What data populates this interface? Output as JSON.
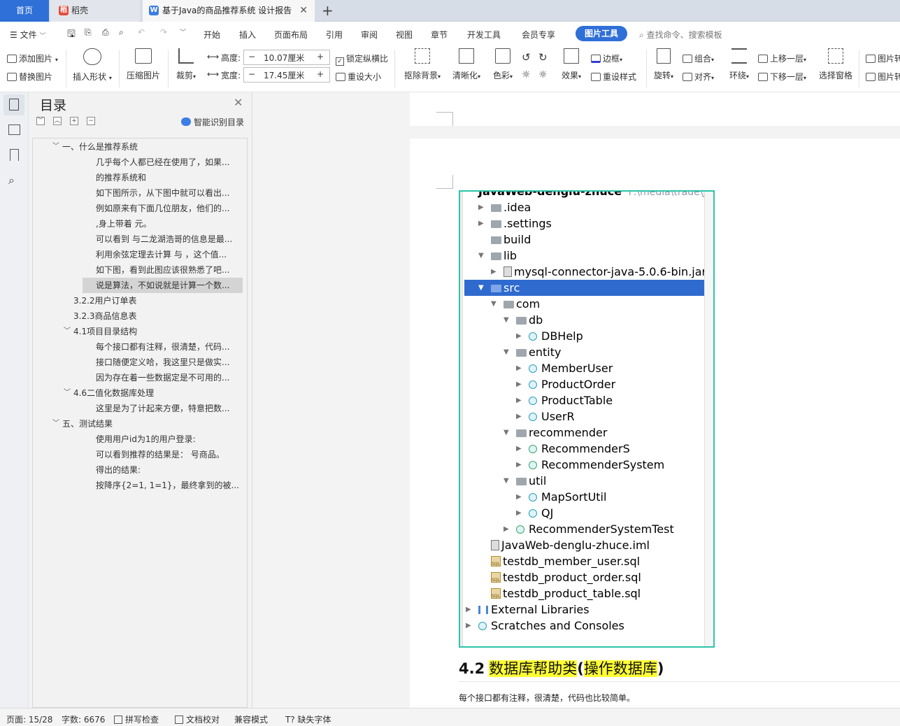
{
  "tabs": {
    "home": "首页",
    "daoke": "稻壳",
    "doc": "基于Java的商品推荐系统 设计报告"
  },
  "menu": {
    "file": "文件",
    "items": [
      "开始",
      "插入",
      "页面布局",
      "引用",
      "审阅",
      "视图",
      "章节",
      "开发工具",
      "会员专享"
    ],
    "active": "图片工具",
    "search": "查找命令、搜索模板"
  },
  "ribbon": {
    "add_picture": "添加图片",
    "replace_picture": "替换图片",
    "insert_shape": "插入形状",
    "compress": "压缩图片",
    "crop": "裁剪",
    "height_label": "高度:",
    "height_value": "10.07厘米",
    "width_label": "宽度:",
    "width_value": "17.45厘米",
    "lock_ratio": "锁定纵横比",
    "reset_size": "重设大小",
    "remove_bg": "抠除背景",
    "sharpen": "清晰化",
    "color": "色彩",
    "effects": "效果",
    "border": "边框",
    "reset_style": "重设样式",
    "rotate": "旋转",
    "group": "组合",
    "align": "对齐",
    "wrap": "环绕",
    "bring_forward": "上移一层",
    "send_backward": "下移一层",
    "select_pane": "选择窗格",
    "picture1": "图片转",
    "picture2": "图片转"
  },
  "toc": {
    "title": "目录",
    "smart": "智能识别目录",
    "items": [
      {
        "text": "一、什么是推荐系统",
        "level": 1,
        "expanded": true
      },
      {
        "text": "几乎每个人都已经在使用了，如果...",
        "level": 3
      },
      {
        "text": "的推荐系统和",
        "level": 3
      },
      {
        "text": "如下图所示，从下图中就可以看出...",
        "level": 3
      },
      {
        "text": "例如原来有下面几位朋友，他们的...",
        "level": 3
      },
      {
        "text": ",身上带着 元。",
        "level": 3
      },
      {
        "text": "可以看到 与二龙湖浩哥的信息是最...",
        "level": 3
      },
      {
        "text": "利用余弦定理去计算 与 ，这个值...",
        "level": 3
      },
      {
        "text": "如下图，看到此图应该很熟悉了吧...",
        "level": 3
      },
      {
        "text": "说是算法，不如说就是计算一个数...",
        "level": 3,
        "selected": true
      },
      {
        "text": "3.2.2用户订单表",
        "level": 2
      },
      {
        "text": "3.2.3商品信息表",
        "level": 2
      },
      {
        "text": "4.1项目目录结构",
        "level": 2,
        "expanded": true
      },
      {
        "text": "每个接口都有注释，很清楚，代码...",
        "level": 3
      },
      {
        "text": "接口随便定义哈，我这里只是做实...",
        "level": 3
      },
      {
        "text": "因为存在着一些数据定是不可用的...",
        "level": 3
      },
      {
        "text": "4.6二值化数据库处理",
        "level": 2,
        "expanded": true
      },
      {
        "text": "这里是为了计起来方便，特意把数...",
        "level": 3
      },
      {
        "text": "五、测试结果",
        "level": 1,
        "expanded": true
      },
      {
        "text": "使用用户id为1的用户登录:",
        "level": 3
      },
      {
        "text": "可以看到推荐的结果是： 号商品。",
        "level": 3
      },
      {
        "text": "得出的结果:",
        "level": 3
      },
      {
        "text": "按降序{2=1, 1=1}，最终拿到的被...",
        "level": 3
      }
    ]
  },
  "tree": {
    "root": "JavaWeb-denglu-zhuce",
    "root_path": "F:\\media\\trade\\JavaWeb",
    "rows": [
      {
        "text": ".idea",
        "indent": 0,
        "arrow": "right",
        "icon": "folder"
      },
      {
        "text": ".settings",
        "indent": 0,
        "arrow": "right",
        "icon": "folder"
      },
      {
        "text": "build",
        "indent": 0,
        "arrow": "",
        "icon": "folder"
      },
      {
        "text": "lib",
        "indent": 0,
        "arrow": "down",
        "icon": "folder"
      },
      {
        "text": "mysql-connector-java-5.0.6-bin.jar",
        "indent": 1,
        "arrow": "right",
        "icon": "jar"
      },
      {
        "text": "src",
        "indent": 0,
        "arrow": "down",
        "icon": "folder",
        "selected": true
      },
      {
        "text": "com",
        "indent": 1,
        "arrow": "down",
        "icon": "folder"
      },
      {
        "text": "db",
        "indent": 2,
        "arrow": "down",
        "icon": "folder"
      },
      {
        "text": "DBHelp",
        "indent": 3,
        "arrow": "right",
        "icon": "class"
      },
      {
        "text": "entity",
        "indent": 2,
        "arrow": "down",
        "icon": "folder"
      },
      {
        "text": "MemberUser",
        "indent": 3,
        "arrow": "right",
        "icon": "class"
      },
      {
        "text": "ProductOrder",
        "indent": 3,
        "arrow": "right",
        "icon": "class"
      },
      {
        "text": "ProductTable",
        "indent": 3,
        "arrow": "right",
        "icon": "class"
      },
      {
        "text": "UserR",
        "indent": 3,
        "arrow": "right",
        "icon": "class"
      },
      {
        "text": "recommender",
        "indent": 2,
        "arrow": "down",
        "icon": "folder"
      },
      {
        "text": "RecommenderS",
        "indent": 3,
        "arrow": "right",
        "icon": "runclass"
      },
      {
        "text": "RecommenderSystem",
        "indent": 3,
        "arrow": "right",
        "icon": "runclass"
      },
      {
        "text": "util",
        "indent": 2,
        "arrow": "down",
        "icon": "folder"
      },
      {
        "text": "MapSortUtil",
        "indent": 3,
        "arrow": "right",
        "icon": "class"
      },
      {
        "text": "QJ",
        "indent": 3,
        "arrow": "right",
        "icon": "class"
      },
      {
        "text": "RecommenderSystemTest",
        "indent": 2,
        "arrow": "right",
        "icon": "runclass"
      },
      {
        "text": "JavaWeb-denglu-zhuce.iml",
        "indent": 0,
        "arrow": "",
        "icon": "file"
      },
      {
        "text": "testdb_member_user.sql",
        "indent": 0,
        "arrow": "",
        "icon": "sql"
      },
      {
        "text": "testdb_product_order.sql",
        "indent": 0,
        "arrow": "",
        "icon": "sql"
      },
      {
        "text": "testdb_product_table.sql",
        "indent": 0,
        "arrow": "",
        "icon": "sql"
      },
      {
        "text": "External Libraries",
        "indent": -1,
        "arrow": "right",
        "icon": "lib"
      },
      {
        "text": "Scratches and Consoles",
        "indent": -1,
        "arrow": "right",
        "icon": "scratch"
      }
    ]
  },
  "doc": {
    "heading_num": "4.2",
    "heading_a": "数据库帮助类",
    "heading_lp": "(",
    "heading_b": "操作数据库",
    "heading_rp": ")",
    "paragraph": "每个接口都有注释，很清楚，代码也比较简单。"
  },
  "status": {
    "page": "页面: 15/28",
    "words": "字数: 6676",
    "spell": "拼写检查",
    "proof": "文档校对",
    "compat": "兼容模式",
    "missing_font": "缺失字体"
  },
  "colors": {
    "accent": "#2f6fd8",
    "selection": "#2f6bcf",
    "image_border": "#2ec4a9",
    "highlight": "#ffff33"
  }
}
